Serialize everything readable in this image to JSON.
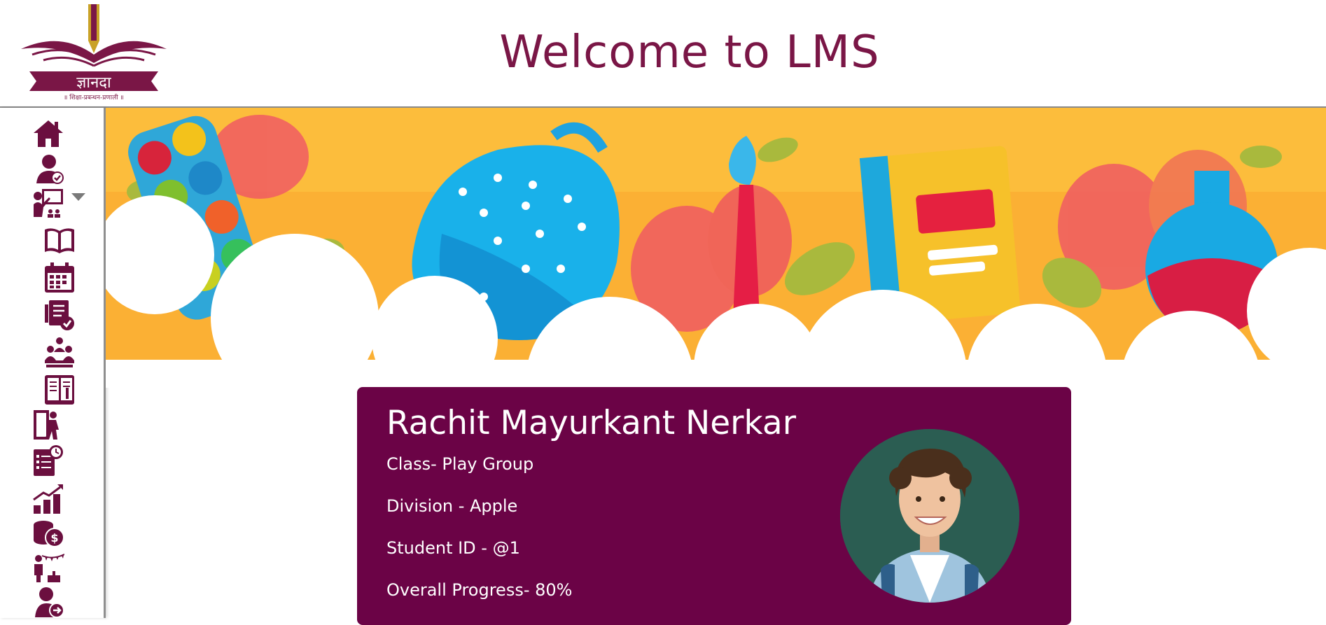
{
  "header": {
    "title": "Welcome to LMS",
    "logo": {
      "name": "ज्ञानदा",
      "tagline": "॥ शिक्षा-प्रबन्धन-प्रणाली ॥"
    }
  },
  "sidebar": {
    "items": [
      {
        "icon": "home-icon"
      },
      {
        "icon": "user-check-icon"
      },
      {
        "icon": "teacher-board-icon",
        "expandable": true
      },
      {
        "icon": "open-book-icon"
      },
      {
        "icon": "calendar-icon"
      },
      {
        "icon": "checklist-icon"
      },
      {
        "icon": "classroom-icon"
      },
      {
        "icon": "study-material-icon"
      },
      {
        "icon": "exit-door-icon"
      },
      {
        "icon": "timed-test-icon"
      },
      {
        "icon": "progress-chart-icon"
      },
      {
        "icon": "fees-icon"
      },
      {
        "icon": "events-icon"
      },
      {
        "icon": "logout-icon"
      }
    ]
  },
  "student": {
    "name": "Rachit Mayurkant Nerkar",
    "class_text": "Class- Play Group",
    "division_text": "Division - Apple",
    "id_text": "Student ID - @1",
    "progress_text": "Overall Progress- 80%"
  },
  "colors": {
    "brand": "#6b0346",
    "title": "#7a1646",
    "banner_bg": "#fbb034",
    "icon": "#6b0f3f"
  }
}
